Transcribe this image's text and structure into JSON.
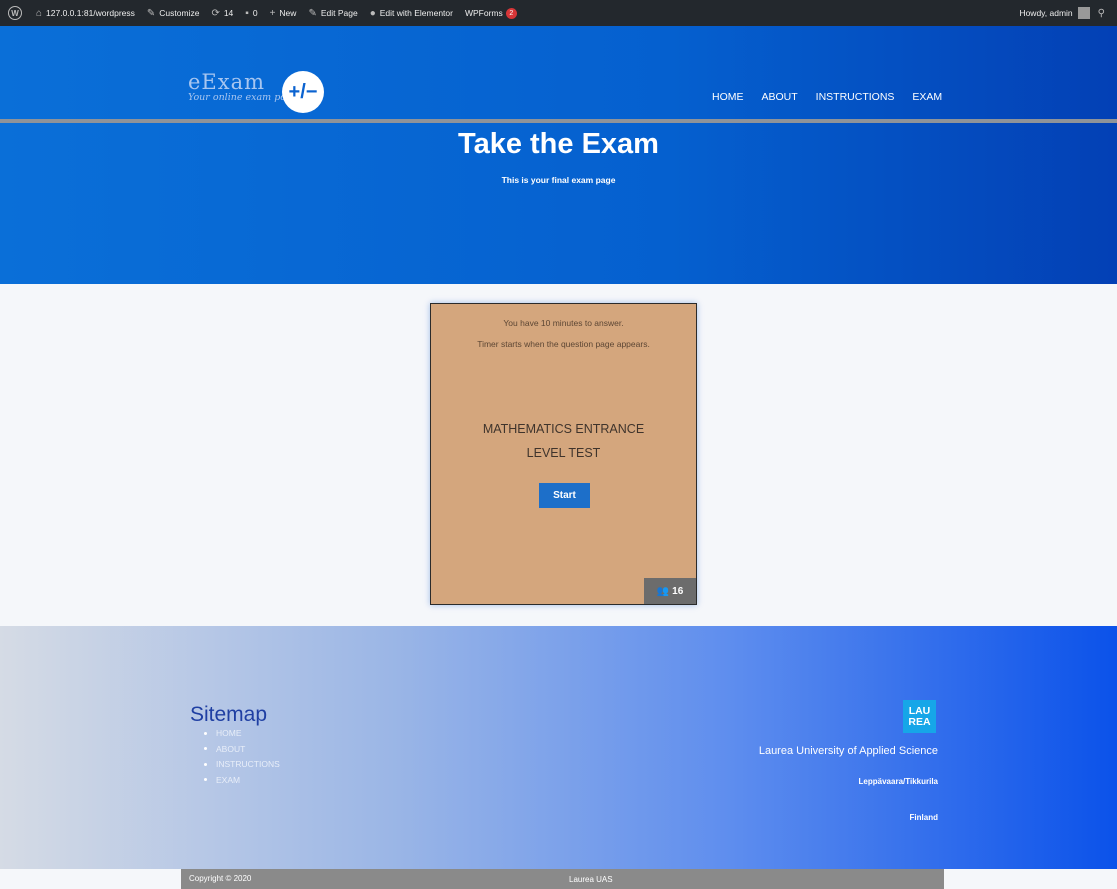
{
  "admin_bar": {
    "site": "127.0.0.1:81/wordpress",
    "customize": "Customize",
    "updates": "14",
    "comments": "0",
    "new": "New",
    "edit_page": "Edit Page",
    "elementor": "Edit with Elementor",
    "wpforms": "WPForms",
    "wpforms_badge": "2",
    "howdy": "Howdy, admin"
  },
  "header": {
    "logo_name": "eExam",
    "logo_symbol": "+/−",
    "logo_tagline": "Your online exam portal",
    "nav": [
      "HOME",
      "ABOUT",
      "INSTRUCTIONS",
      "EXAM"
    ],
    "title": "Take the Exam",
    "subtitle": "This is your final exam page"
  },
  "exam_card": {
    "line1": "You have 10 minutes to answer.",
    "line2": "Timer starts when the question page appears.",
    "title_line1": "MATHEMATICS ENTRANCE",
    "title_line2": "LEVEL TEST",
    "start_label": "Start",
    "participants": "16",
    "background_color": "#d4a67d"
  },
  "footer": {
    "sitemap_title": "Sitemap",
    "sitemap_items": [
      "HOME",
      "ABOUT",
      "INSTRUCTIONS",
      "EXAM"
    ],
    "logo_text_top": "LAU",
    "logo_text_bottom": "REA",
    "university": "Laurea University of Applied Science",
    "campus": "Leppävaara/Tikkurila",
    "country": "Finland",
    "copyright": "Copyright © 2020",
    "brand": "Laurea UAS"
  },
  "colors": {
    "admin_bar": "#23282d",
    "hero_blue": "#0560cf",
    "start_button": "#1d6fc9",
    "laurea_logo": "#16a6e8"
  }
}
